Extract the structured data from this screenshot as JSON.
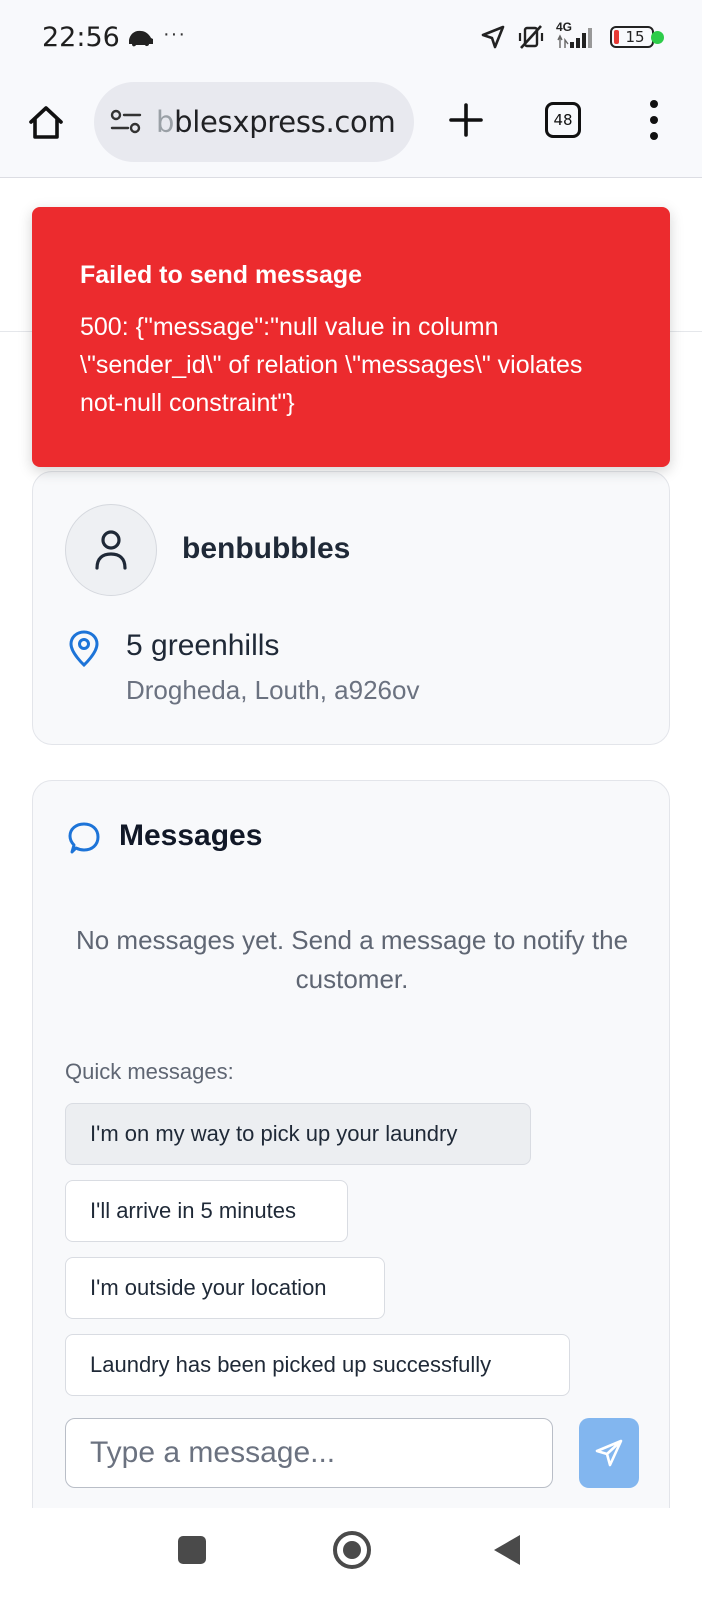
{
  "status_bar": {
    "time": "22:56",
    "overflow_indicator": "···",
    "network_label": "4G",
    "battery_level": "15",
    "icons": [
      "car-notification-icon",
      "location-arrow-icon",
      "vibrate-off-icon",
      "signal-bars-icon",
      "battery-icon"
    ]
  },
  "browser": {
    "url_dim": "b",
    "url_text": "blesxpress.com",
    "tab_count": "48",
    "icons": [
      "home-icon",
      "site-settings-icon",
      "new-tab-plus-icon",
      "more-menu-icon"
    ]
  },
  "toast": {
    "title": "Failed to send message",
    "body": "500: {\"message\":\"null value in column \\\"sender_id\\\" of relation \\\"messages\\\" violates not-null constraint\"}",
    "color": "#ec2b2e"
  },
  "customer": {
    "name": "benbubbles",
    "address_line1": "5 greenhills",
    "address_line2": "Drogheda, Louth, a926ov",
    "icons": [
      "user-icon",
      "map-pin-icon"
    ]
  },
  "messages": {
    "title": "Messages",
    "empty_text": "No messages yet. Send a message to notify the customer.",
    "quick_label": "Quick messages:",
    "quick_messages": [
      "I'm on my way to pick up your laundry",
      "I'll arrive in 5 minutes",
      "I'm outside your location",
      "Laundry has been picked up successfully"
    ],
    "input_placeholder": "Type a message...",
    "send_button_color": "#82b6ef",
    "icons": [
      "chat-bubble-icon",
      "send-icon"
    ]
  },
  "nav_bar": {
    "icons": [
      "recents-square-icon",
      "home-circle-icon",
      "back-triangle-icon"
    ]
  }
}
